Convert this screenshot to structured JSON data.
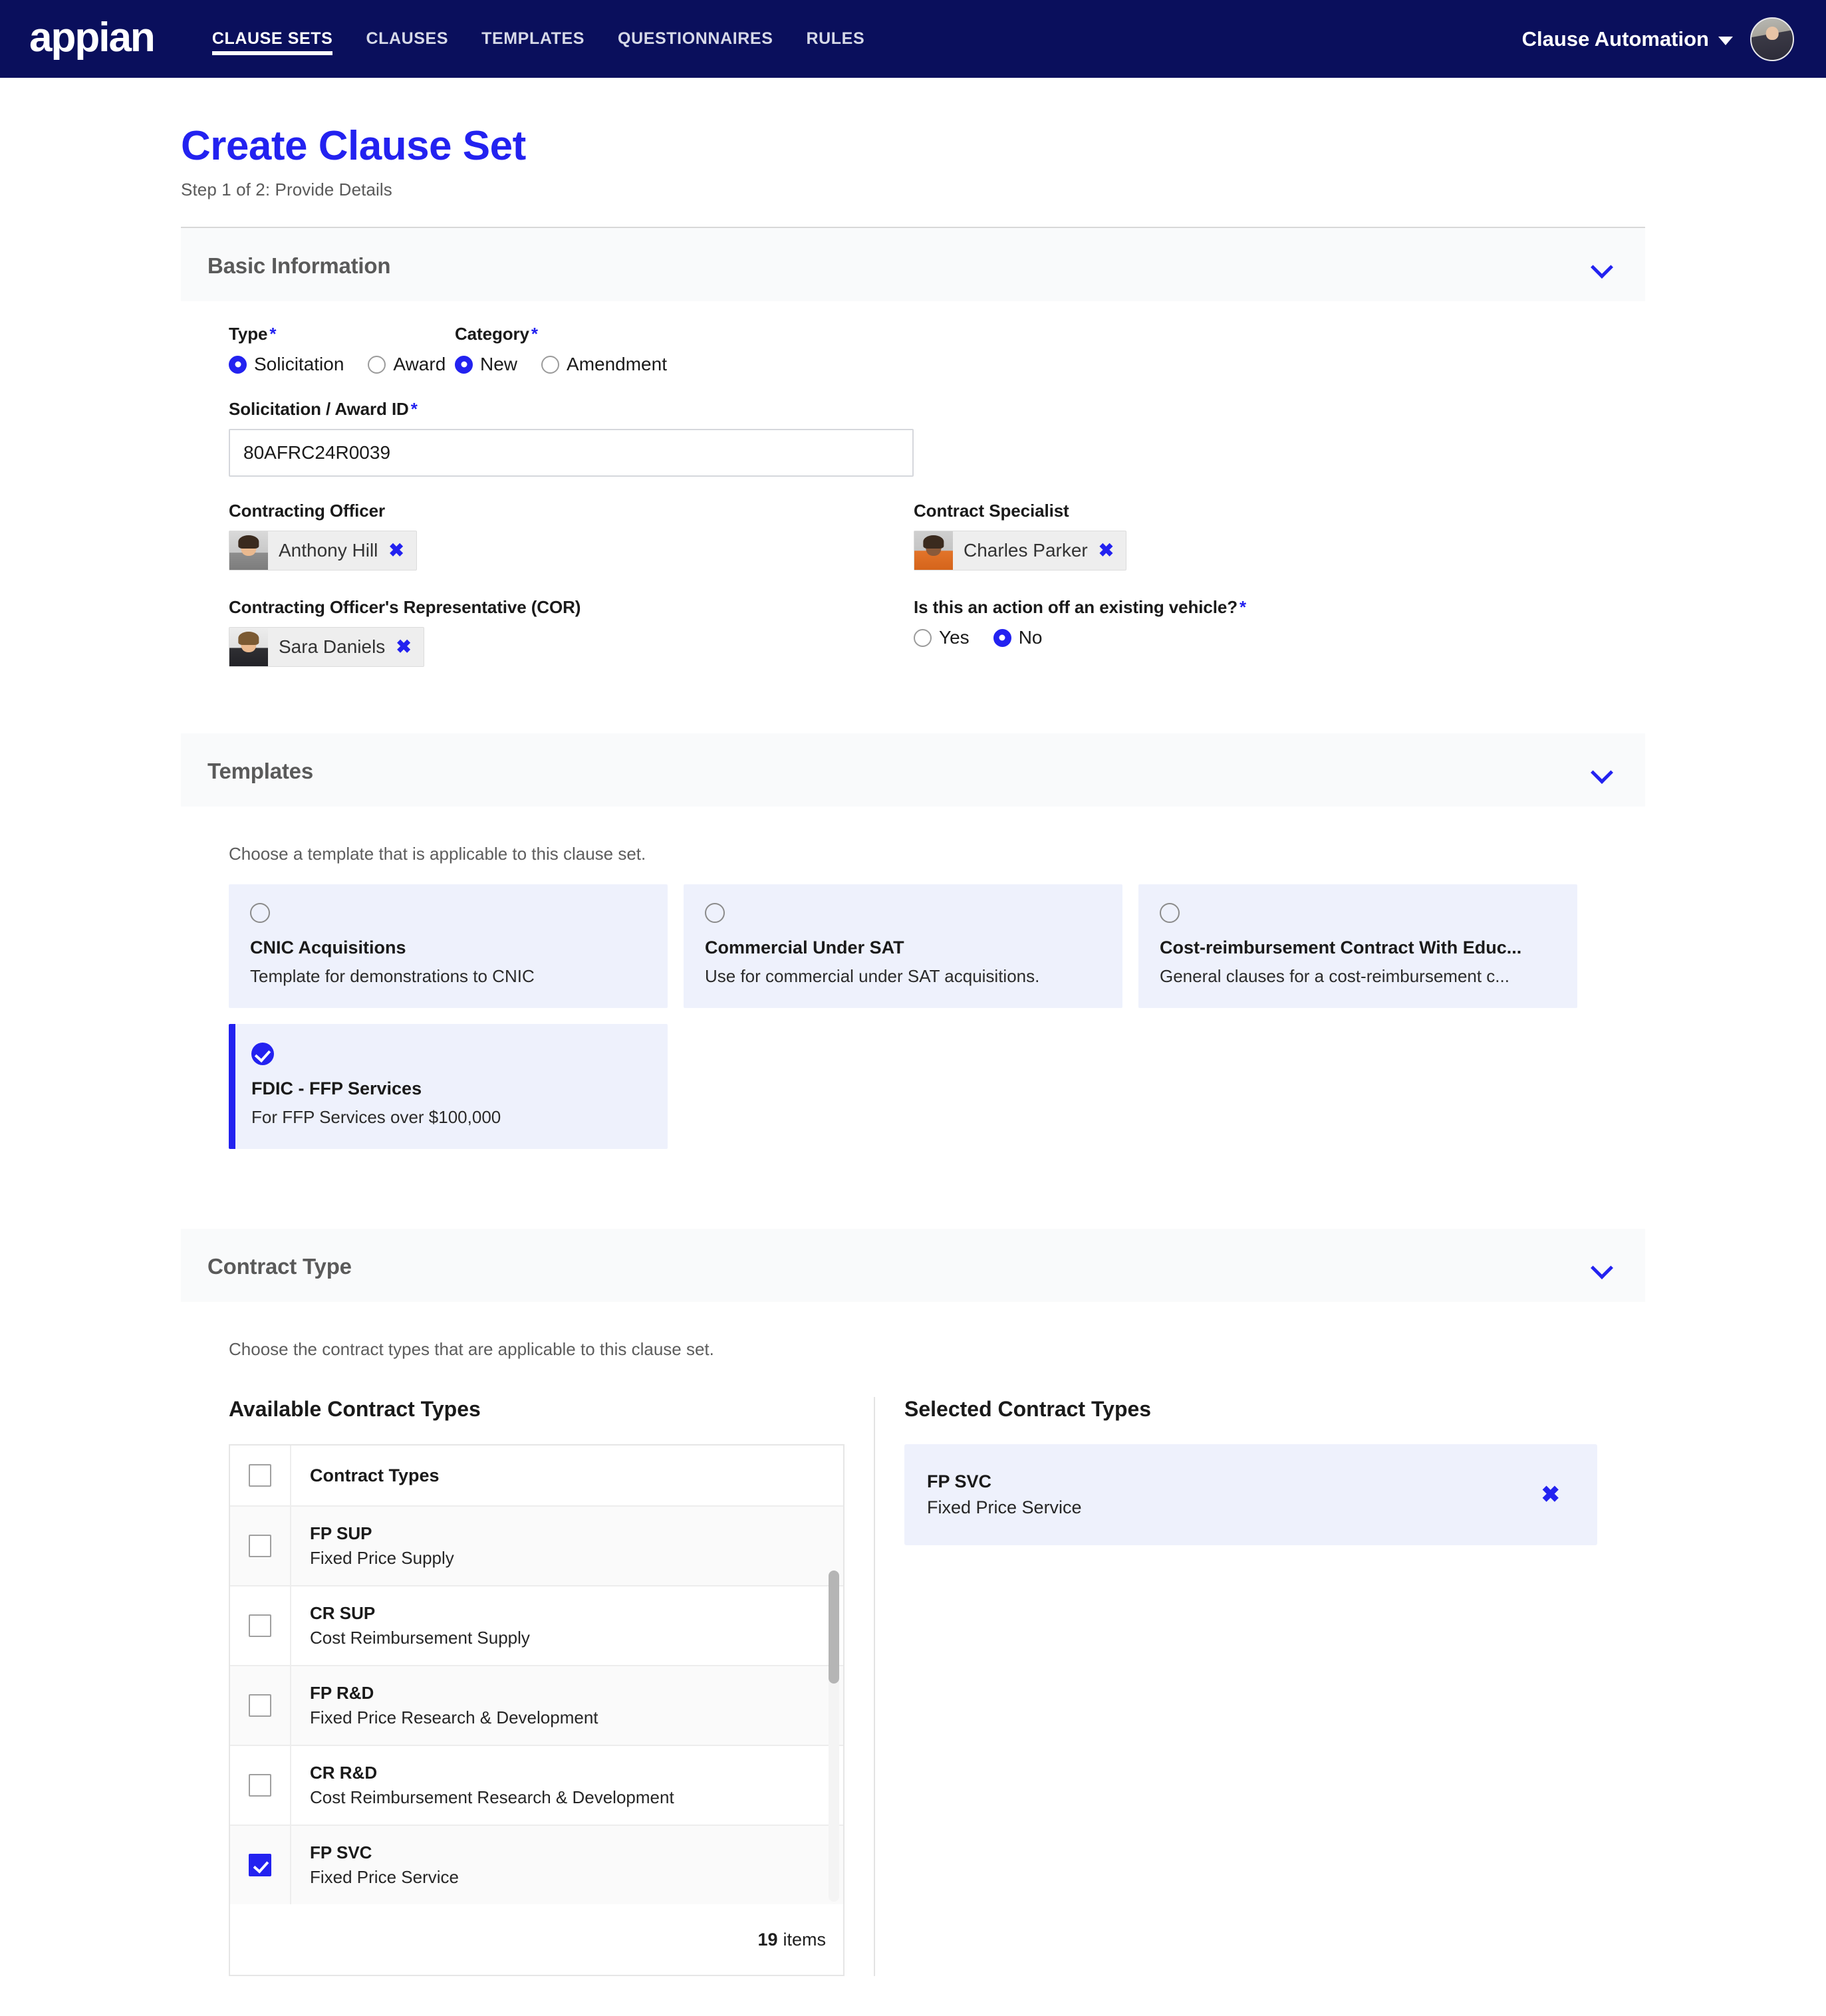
{
  "nav": {
    "brand": "appian",
    "links": [
      {
        "label": "CLAUSE SETS",
        "active": true
      },
      {
        "label": "CLAUSES",
        "active": false
      },
      {
        "label": "TEMPLATES",
        "active": false
      },
      {
        "label": "QUESTIONNAIRES",
        "active": false
      },
      {
        "label": "RULES",
        "active": false
      }
    ],
    "user_menu": "Clause Automation"
  },
  "page": {
    "title": "Create Clause Set",
    "step": "Step 1 of 2: Provide Details"
  },
  "basic_information": {
    "heading": "Basic Information",
    "type": {
      "label": "Type",
      "required": "*",
      "options": [
        {
          "label": "Solicitation",
          "selected": true
        },
        {
          "label": "Award",
          "selected": false
        }
      ]
    },
    "category": {
      "label": "Category",
      "required": "*",
      "options": [
        {
          "label": "New",
          "selected": true
        },
        {
          "label": "Amendment",
          "selected": false
        }
      ]
    },
    "solicitation_id": {
      "label": "Solicitation / Award ID",
      "required": "*",
      "value": "80AFRC24R0039"
    },
    "contracting_officer": {
      "label": "Contracting Officer",
      "value": "Anthony Hill"
    },
    "contract_specialist": {
      "label": "Contract Specialist",
      "value": "Charles Parker"
    },
    "cor": {
      "label": "Contracting Officer's Representative (COR)",
      "value": "Sara Daniels"
    },
    "existing_vehicle": {
      "label": "Is this an action off an existing vehicle?",
      "required": "*",
      "options": [
        {
          "label": "Yes",
          "selected": false
        },
        {
          "label": "No",
          "selected": true
        }
      ]
    }
  },
  "templates": {
    "heading": "Templates",
    "helper": "Choose a template that is applicable to this clause set.",
    "cards": [
      {
        "name": "CNIC Acquisitions",
        "desc": "Template for demonstrations to CNIC",
        "selected": false
      },
      {
        "name": "Commercial Under SAT",
        "desc": "Use for commercial under SAT acquisitions.",
        "selected": false
      },
      {
        "name": "Cost-reimbursement Contract With Educ...",
        "desc": "General clauses for a cost-reimbursement c...",
        "selected": false
      },
      {
        "name": "FDIC - FFP Services",
        "desc": "For FFP Services over $100,000",
        "selected": true
      }
    ]
  },
  "contract_type": {
    "heading": "Contract Type",
    "helper": "Choose the contract types that are applicable to this clause set.",
    "available_heading": "Available Contract Types",
    "selected_heading": "Selected Contract Types",
    "column_header": "Contract Types",
    "rows": [
      {
        "code": "FP SUP",
        "name": "Fixed Price Supply",
        "checked": false
      },
      {
        "code": "CR SUP",
        "name": "Cost Reimbursement Supply",
        "checked": false
      },
      {
        "code": "FP R&D",
        "name": "Fixed Price Research & Development",
        "checked": false
      },
      {
        "code": "CR R&D",
        "name": "Cost Reimbursement Research & Development",
        "checked": false
      },
      {
        "code": "FP SVC",
        "name": "Fixed Price Service",
        "checked": true
      }
    ],
    "item_count": "19",
    "item_count_label": "items",
    "selected": [
      {
        "code": "FP SVC",
        "name": "Fixed Price Service"
      }
    ]
  },
  "colors": {
    "nav_bg": "#0a0f5c",
    "accent": "#2322f0",
    "card_bg": "#eef1fc",
    "section_header_bg": "#f9fafb"
  }
}
